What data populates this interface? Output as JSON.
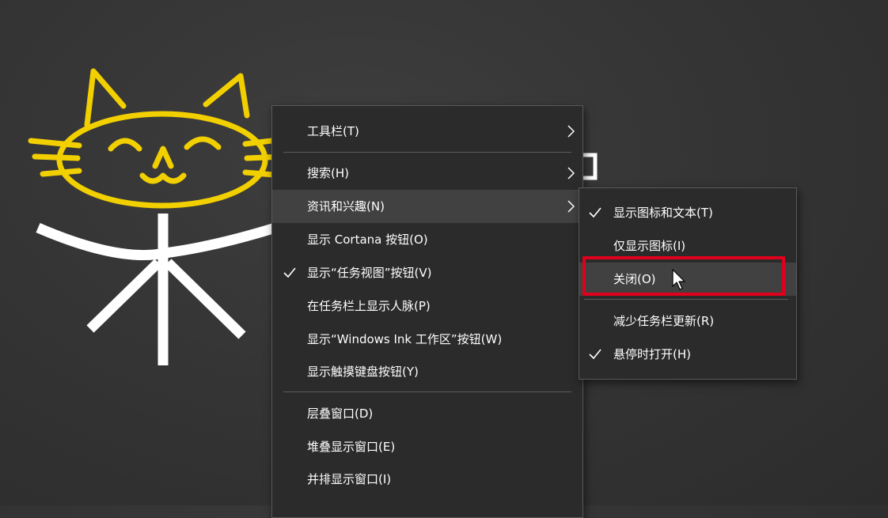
{
  "main_menu": {
    "items": [
      {
        "label": "工具栏(T)",
        "checked": false,
        "submenu": true
      },
      {
        "label": "搜索(H)",
        "checked": false,
        "submenu": true
      },
      {
        "label": "资讯和兴趣(N)",
        "checked": false,
        "submenu": true
      },
      {
        "label": "显示 Cortana 按钮(O)",
        "checked": false,
        "submenu": false
      },
      {
        "label": "显示“任务视图”按钮(V)",
        "checked": true,
        "submenu": false
      },
      {
        "label": "在任务栏上显示人脉(P)",
        "checked": false,
        "submenu": false
      },
      {
        "label": "显示“Windows Ink 工作区”按钮(W)",
        "checked": false,
        "submenu": false
      },
      {
        "label": "显示触摸键盘按钮(Y)",
        "checked": false,
        "submenu": false
      },
      {
        "label": "层叠窗口(D)",
        "checked": false,
        "submenu": false
      },
      {
        "label": "堆叠显示窗口(E)",
        "checked": false,
        "submenu": false
      },
      {
        "label": "并排显示窗口(I)",
        "checked": false,
        "submenu": false
      }
    ]
  },
  "news_submenu": {
    "items": [
      {
        "label": "显示图标和文本(T)",
        "checked": true
      },
      {
        "label": "仅显示图标(I)",
        "checked": false
      },
      {
        "label": "关闭(O)",
        "checked": false,
        "highlighted": true
      },
      {
        "label": "减少任务栏更新(R)",
        "checked": false
      },
      {
        "label": "悬停时打开(H)",
        "checked": true
      }
    ]
  },
  "colors": {
    "menu_bg": "#2b2b2b",
    "hover_bg": "#414141",
    "highlight_box": "#e0001b",
    "logo_yellow": "#f2d000",
    "logo_white": "#ffffff"
  },
  "icons": [
    "cat-logo",
    "check-icon",
    "chevron-right-icon",
    "mouse-cursor-icon"
  ]
}
